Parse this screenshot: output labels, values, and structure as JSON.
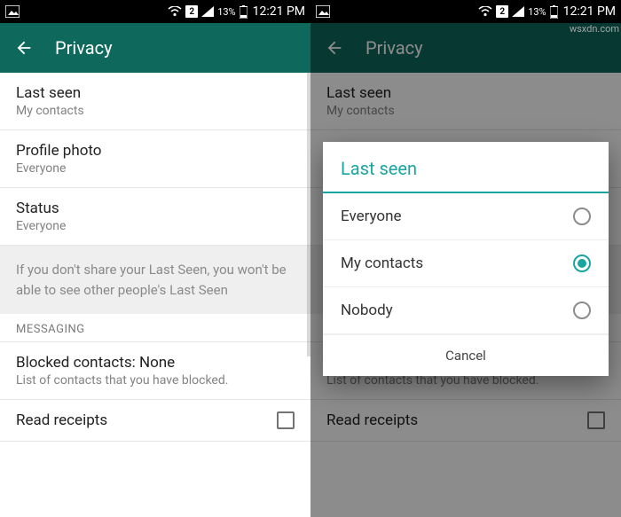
{
  "status": {
    "sim_label": "2",
    "battery_percent": "13%",
    "time": "12:21 PM"
  },
  "appbar": {
    "title": "Privacy"
  },
  "settings": {
    "last_seen": {
      "title": "Last seen",
      "value": "My contacts"
    },
    "profile_photo": {
      "title": "Profile photo",
      "value": "Everyone"
    },
    "status": {
      "title": "Status",
      "value": "Everyone"
    },
    "note": "If you don't share your Last Seen, you won't be able to see other people's Last Seen",
    "section_messaging": "MESSAGING",
    "blocked": {
      "title": "Blocked contacts: None",
      "sub": "List of contacts that you have blocked."
    },
    "read_receipts": {
      "title": "Read receipts"
    }
  },
  "dialog": {
    "title": "Last seen",
    "options": [
      "Everyone",
      "My contacts",
      "Nobody"
    ],
    "selected_index": 1,
    "cancel": "Cancel"
  },
  "watermark": "wsxdn.com"
}
